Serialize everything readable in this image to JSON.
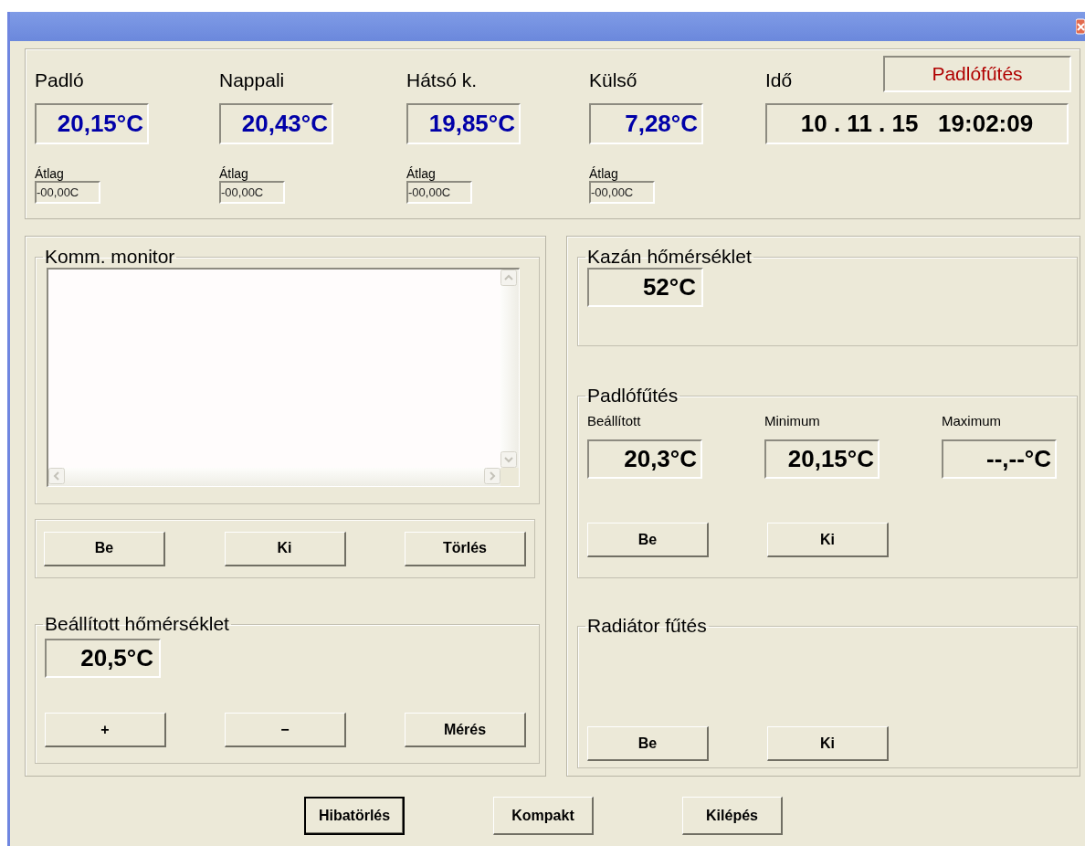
{
  "sensors": [
    {
      "label": "Padló",
      "value": "20,15°C",
      "avg_label": "Átlag",
      "avg_value": "-00,00C"
    },
    {
      "label": "Nappali",
      "value": "20,43°C",
      "avg_label": "Átlag",
      "avg_value": "-00,00C"
    },
    {
      "label": "Hátsó k.",
      "value": "19,85°C",
      "avg_label": "Átlag",
      "avg_value": "-00,00C"
    },
    {
      "label": "Külső",
      "value": "7,28°C",
      "avg_label": "Átlag",
      "avg_value": "-00,00C"
    }
  ],
  "clock": {
    "label": "Idő",
    "value": "10 . 11 . 15   19:02:09"
  },
  "mode_indicator": "Padlófűtés",
  "monitor": {
    "title": "Komm. monitor",
    "buttons": [
      "Be",
      "Ki",
      "Törlés"
    ]
  },
  "setpoint": {
    "title": "Beállított hőmérséklet",
    "value": "20,5°C",
    "buttons": [
      "+",
      "−",
      "Mérés"
    ]
  },
  "boiler": {
    "title": "Kazán hőmérséklet",
    "value": "52°C"
  },
  "floor_heating": {
    "title": "Padlófűtés",
    "readings": [
      {
        "label": "Beállított",
        "value": "20,3°C"
      },
      {
        "label": "Minimum",
        "value": "20,15°C"
      },
      {
        "label": "Maximum",
        "value": "--,--°C"
      }
    ],
    "buttons": [
      "Be",
      "Ki"
    ]
  },
  "radiator": {
    "title": "Radiátor fűtés",
    "buttons": [
      "Be",
      "Ki"
    ]
  },
  "footer_buttons": [
    {
      "label": "Hibatörlés",
      "focused": true
    },
    {
      "label": "Kompakt",
      "focused": false
    },
    {
      "label": "Kilépés",
      "focused": false
    }
  ]
}
